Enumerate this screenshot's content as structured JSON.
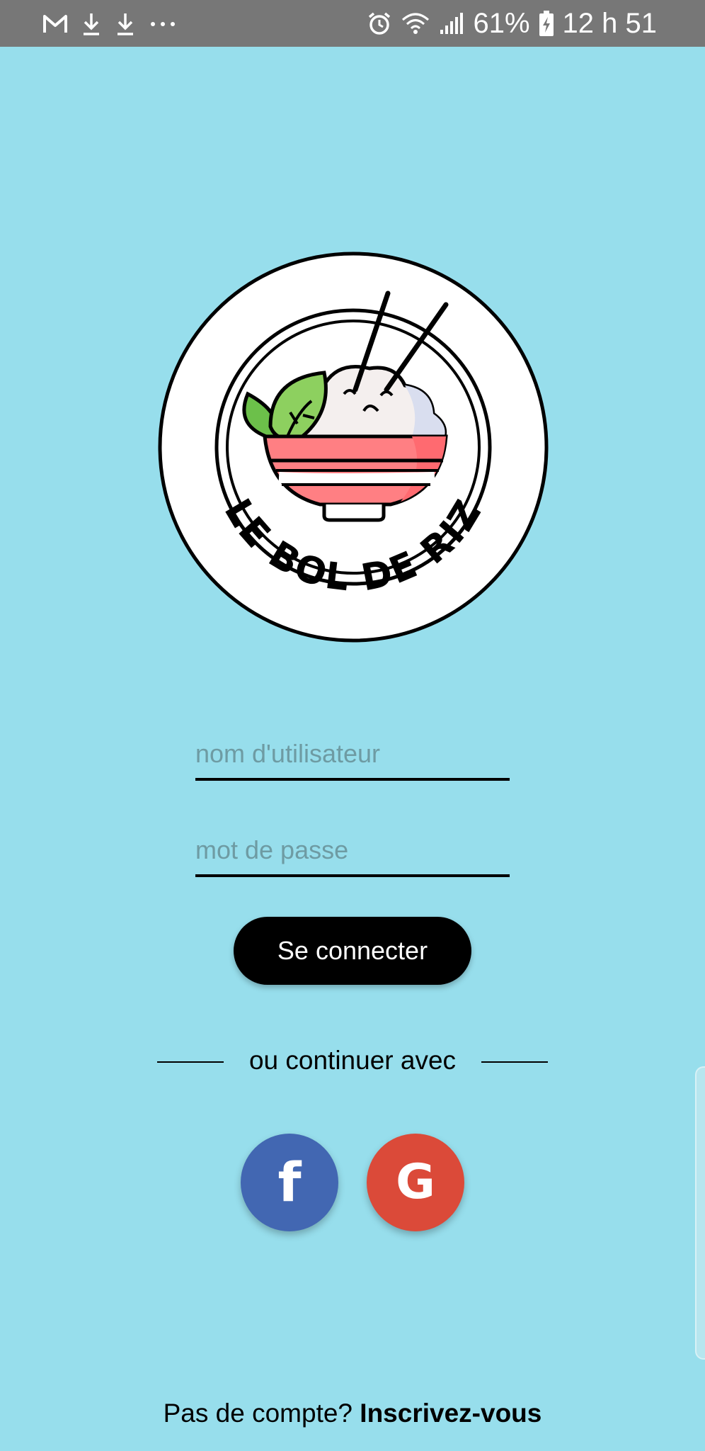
{
  "status_bar": {
    "battery": "61%",
    "time": "12 h 51",
    "left_icons": [
      "gmail-icon",
      "download-icon",
      "download-icon",
      "more-dots-icon"
    ],
    "right_icons": [
      "alarm-icon",
      "wifi-icon",
      "signal-icon",
      "battery-charging-icon"
    ]
  },
  "logo": {
    "text": "LE BOL DE RIZ"
  },
  "login": {
    "username_placeholder": "nom d'utilisateur",
    "password_placeholder": "mot de passe",
    "submit_label": "Se connecter"
  },
  "divider": {
    "text": "ou continuer avec"
  },
  "social": {
    "facebook_label": "f",
    "google_label": "G",
    "facebook_color": "#4267B2",
    "google_color": "#DB4A39"
  },
  "signup": {
    "prompt": "Pas de compte? ",
    "link": "Inscrivez-vous"
  },
  "colors": {
    "background": "#97DEEC",
    "status_bar": "#777777",
    "button": "#000000",
    "bowl": "#FF7F83"
  }
}
